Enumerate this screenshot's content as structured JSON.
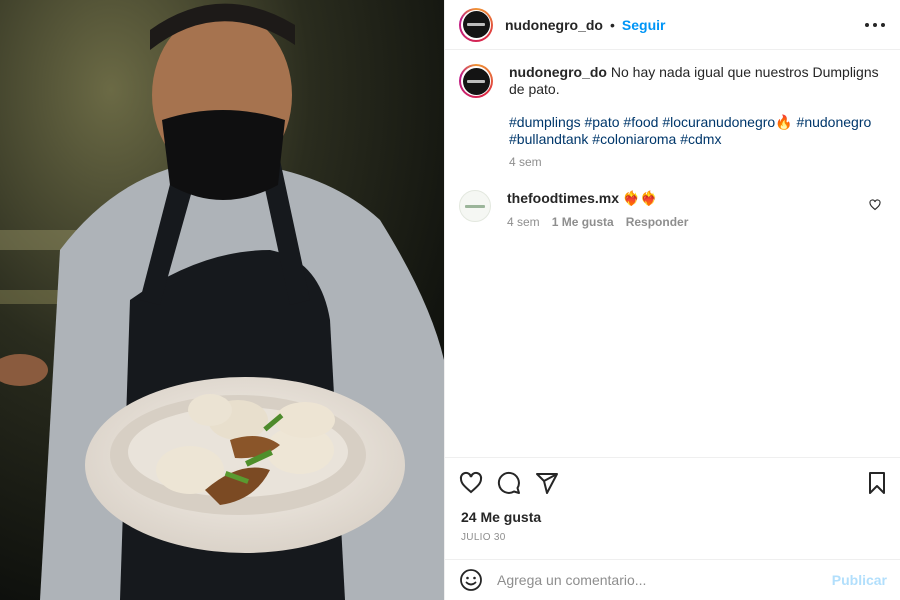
{
  "photo": {
    "icon": "food-photo",
    "description_colors": {
      "apron": "#15181c",
      "shirt": "#c9cdd2",
      "plate": "#efe9e1"
    }
  },
  "header": {
    "username": "nudonegro_do",
    "separator": "•",
    "follow_label": "Seguir",
    "more_icon": "more-options-icon"
  },
  "caption": {
    "username": "nudonegro_do",
    "text": "No hay nada igual que nuestros Dumpligns de pato.",
    "hashtags": "#dumplings #pato #food #locuranudonegro🔥 #nudonegro #bullandtank #coloniaroma #cdmx",
    "time": "4 sem"
  },
  "comment": {
    "username": "thefoodtimes.mx",
    "text": "❤️‍🔥❤️‍🔥",
    "time": "4 sem",
    "likes": "1 Me gusta",
    "reply": "Responder"
  },
  "actions": {
    "likes_count": "24 Me gusta",
    "date": "JULIO 30"
  },
  "add_comment": {
    "placeholder": "Agrega un comentario...",
    "publish_label": "Publicar"
  },
  "colors": {
    "link": "#00376b",
    "follow": "#0095f6",
    "publish_disabled": "#b2dffc",
    "muted": "#8e8e8e"
  }
}
